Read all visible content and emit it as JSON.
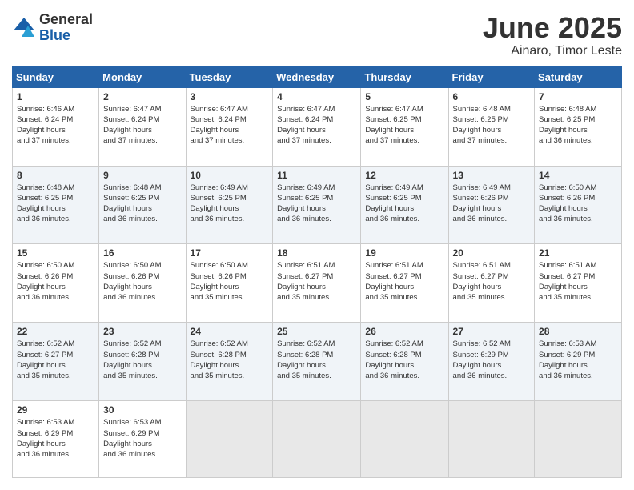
{
  "header": {
    "logo_general": "General",
    "logo_blue": "Blue",
    "month_title": "June 2025",
    "location": "Ainaro, Timor Leste"
  },
  "days_of_week": [
    "Sunday",
    "Monday",
    "Tuesday",
    "Wednesday",
    "Thursday",
    "Friday",
    "Saturday"
  ],
  "weeks": [
    [
      {
        "day": "1",
        "sunrise": "6:46 AM",
        "sunset": "6:24 PM",
        "daylight": "11 hours and 37 minutes."
      },
      {
        "day": "2",
        "sunrise": "6:47 AM",
        "sunset": "6:24 PM",
        "daylight": "11 hours and 37 minutes."
      },
      {
        "day": "3",
        "sunrise": "6:47 AM",
        "sunset": "6:24 PM",
        "daylight": "11 hours and 37 minutes."
      },
      {
        "day": "4",
        "sunrise": "6:47 AM",
        "sunset": "6:24 PM",
        "daylight": "11 hours and 37 minutes."
      },
      {
        "day": "5",
        "sunrise": "6:47 AM",
        "sunset": "6:25 PM",
        "daylight": "11 hours and 37 minutes."
      },
      {
        "day": "6",
        "sunrise": "6:48 AM",
        "sunset": "6:25 PM",
        "daylight": "11 hours and 37 minutes."
      },
      {
        "day": "7",
        "sunrise": "6:48 AM",
        "sunset": "6:25 PM",
        "daylight": "11 hours and 36 minutes."
      }
    ],
    [
      {
        "day": "8",
        "sunrise": "6:48 AM",
        "sunset": "6:25 PM",
        "daylight": "11 hours and 36 minutes."
      },
      {
        "day": "9",
        "sunrise": "6:48 AM",
        "sunset": "6:25 PM",
        "daylight": "11 hours and 36 minutes."
      },
      {
        "day": "10",
        "sunrise": "6:49 AM",
        "sunset": "6:25 PM",
        "daylight": "11 hours and 36 minutes."
      },
      {
        "day": "11",
        "sunrise": "6:49 AM",
        "sunset": "6:25 PM",
        "daylight": "11 hours and 36 minutes."
      },
      {
        "day": "12",
        "sunrise": "6:49 AM",
        "sunset": "6:25 PM",
        "daylight": "11 hours and 36 minutes."
      },
      {
        "day": "13",
        "sunrise": "6:49 AM",
        "sunset": "6:26 PM",
        "daylight": "11 hours and 36 minutes."
      },
      {
        "day": "14",
        "sunrise": "6:50 AM",
        "sunset": "6:26 PM",
        "daylight": "11 hours and 36 minutes."
      }
    ],
    [
      {
        "day": "15",
        "sunrise": "6:50 AM",
        "sunset": "6:26 PM",
        "daylight": "11 hours and 36 minutes."
      },
      {
        "day": "16",
        "sunrise": "6:50 AM",
        "sunset": "6:26 PM",
        "daylight": "11 hours and 36 minutes."
      },
      {
        "day": "17",
        "sunrise": "6:50 AM",
        "sunset": "6:26 PM",
        "daylight": "11 hours and 35 minutes."
      },
      {
        "day": "18",
        "sunrise": "6:51 AM",
        "sunset": "6:27 PM",
        "daylight": "11 hours and 35 minutes."
      },
      {
        "day": "19",
        "sunrise": "6:51 AM",
        "sunset": "6:27 PM",
        "daylight": "11 hours and 35 minutes."
      },
      {
        "day": "20",
        "sunrise": "6:51 AM",
        "sunset": "6:27 PM",
        "daylight": "11 hours and 35 minutes."
      },
      {
        "day": "21",
        "sunrise": "6:51 AM",
        "sunset": "6:27 PM",
        "daylight": "11 hours and 35 minutes."
      }
    ],
    [
      {
        "day": "22",
        "sunrise": "6:52 AM",
        "sunset": "6:27 PM",
        "daylight": "11 hours and 35 minutes."
      },
      {
        "day": "23",
        "sunrise": "6:52 AM",
        "sunset": "6:28 PM",
        "daylight": "11 hours and 35 minutes."
      },
      {
        "day": "24",
        "sunrise": "6:52 AM",
        "sunset": "6:28 PM",
        "daylight": "11 hours and 35 minutes."
      },
      {
        "day": "25",
        "sunrise": "6:52 AM",
        "sunset": "6:28 PM",
        "daylight": "11 hours and 35 minutes."
      },
      {
        "day": "26",
        "sunrise": "6:52 AM",
        "sunset": "6:28 PM",
        "daylight": "11 hours and 36 minutes."
      },
      {
        "day": "27",
        "sunrise": "6:52 AM",
        "sunset": "6:29 PM",
        "daylight": "11 hours and 36 minutes."
      },
      {
        "day": "28",
        "sunrise": "6:53 AM",
        "sunset": "6:29 PM",
        "daylight": "11 hours and 36 minutes."
      }
    ],
    [
      {
        "day": "29",
        "sunrise": "6:53 AM",
        "sunset": "6:29 PM",
        "daylight": "11 hours and 36 minutes."
      },
      {
        "day": "30",
        "sunrise": "6:53 AM",
        "sunset": "6:29 PM",
        "daylight": "11 hours and 36 minutes."
      },
      null,
      null,
      null,
      null,
      null
    ]
  ]
}
